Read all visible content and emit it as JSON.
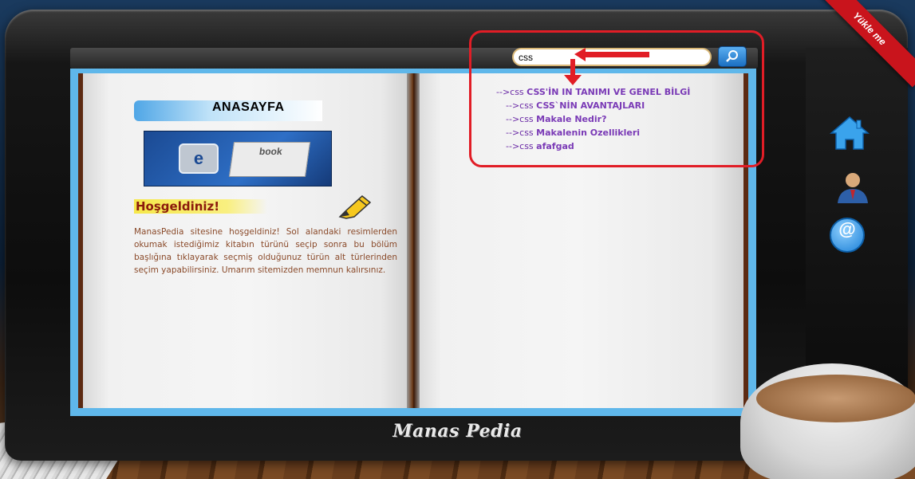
{
  "corner_ribbon": {
    "label": "Yükle me"
  },
  "search": {
    "value": "css",
    "button_icon": "search-icon"
  },
  "search_results": [
    {
      "prefix": "-->css",
      "text": "CSS'İN IN TANIMI VE GENEL BİLGİ"
    },
    {
      "prefix": "-->css",
      "text": "CSS`NİN AVANTAJLARI"
    },
    {
      "prefix": "-->css",
      "text": "Makale Nedir?"
    },
    {
      "prefix": "-->css",
      "text": "Makalenin Ozellikleri"
    },
    {
      "prefix": "-->css",
      "text": "afafgad"
    }
  ],
  "left_page": {
    "header": "ANASAYFA",
    "image_text": {
      "letter": "e",
      "word": "book"
    },
    "welcome_title": "Hoşgeldiniz!",
    "welcome_text": "ManasPedia sitesine hoşgeldiniz! Sol alandaki resimlerden okumak istediğimiz kitabın türünü seçip sonra bu bölüm başlığına tıklayarak seçmiş olduğunuz türün alt türlerinden seçim yapabilirsiniz. Umarım sitemizden memnun kalırsınız."
  },
  "side_nav": [
    {
      "icon": "home-icon"
    },
    {
      "icon": "user-icon"
    },
    {
      "icon": "email-icon",
      "glyph": "@"
    }
  ],
  "brand": {
    "logo_text": "Manas Pedia"
  },
  "colors": {
    "annotation": "#e11d26",
    "link": "#6a2aa6",
    "welcome_title": "#8b1a0c",
    "screen": "#5fb7ea"
  }
}
